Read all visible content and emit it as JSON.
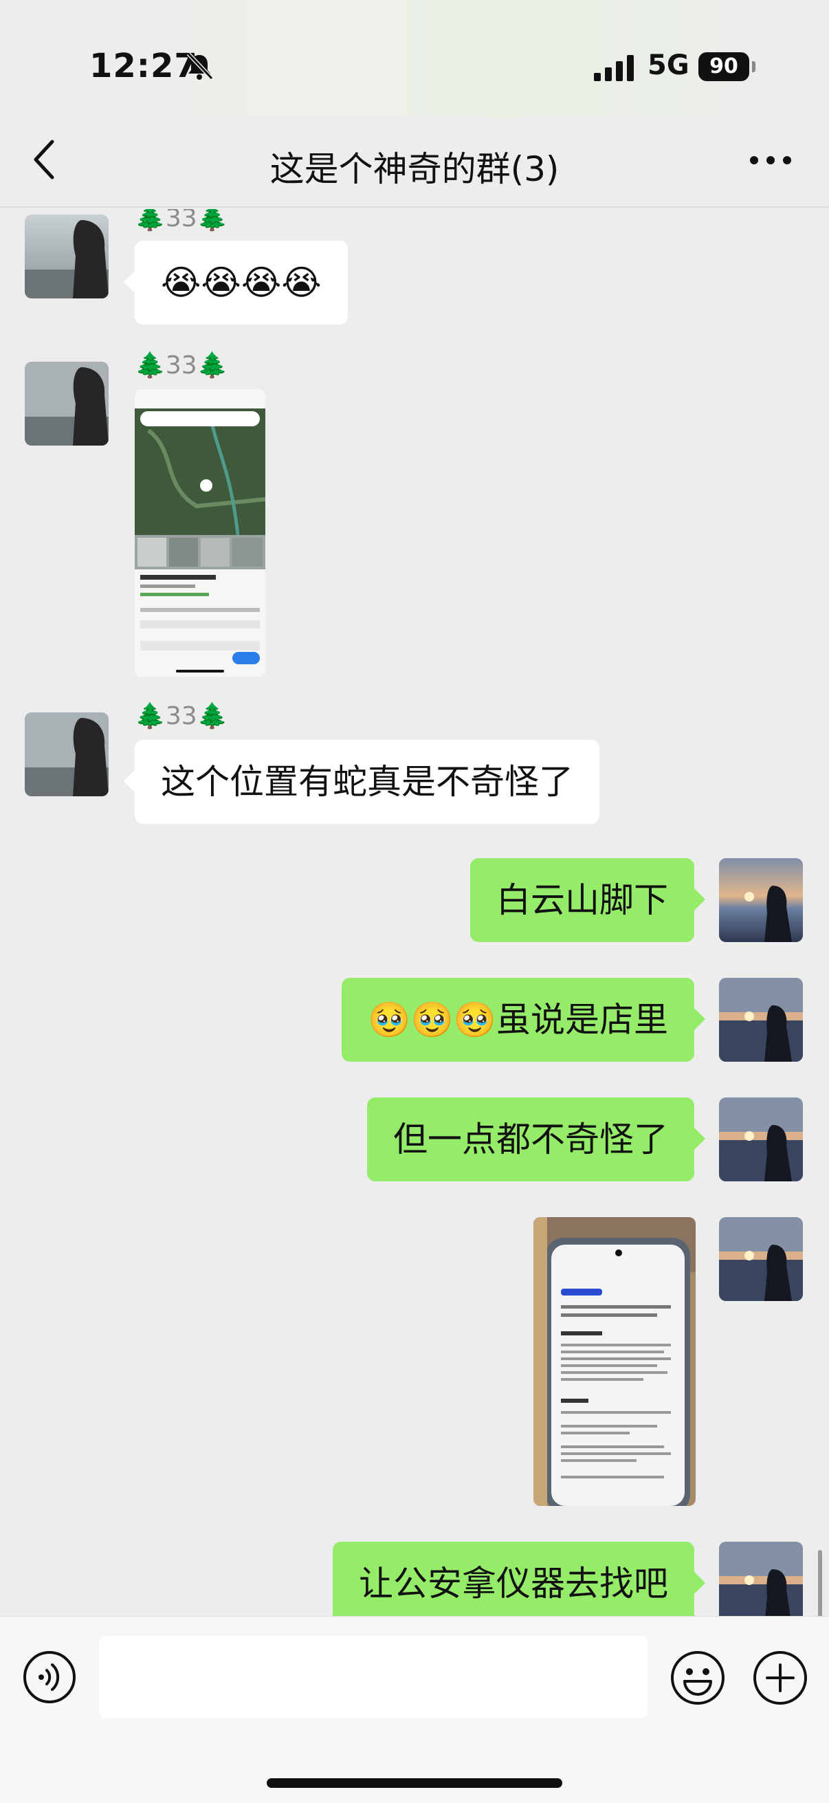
{
  "status_bar": {
    "time": "12:27",
    "network": "5G",
    "battery": "90"
  },
  "nav": {
    "title": "这是个神奇的群(3)"
  },
  "messages": [
    {
      "direction": "incoming",
      "sender": "🌲33🌲",
      "type": "text",
      "text": "😭😭😭😭"
    },
    {
      "direction": "incoming",
      "sender": "🌲33🌲",
      "type": "image",
      "image_desc": "map-screenshot"
    },
    {
      "direction": "incoming",
      "sender": "🌲33🌲",
      "type": "text",
      "text": "这个位置有蛇真是不奇怪了"
    },
    {
      "direction": "outgoing",
      "type": "text",
      "text": "白云山脚下"
    },
    {
      "direction": "outgoing",
      "type": "text",
      "text": "🥹🥹🥹虽说是店里"
    },
    {
      "direction": "outgoing",
      "type": "text",
      "text": "但一点都不奇怪了"
    },
    {
      "direction": "outgoing",
      "type": "image",
      "image_desc": "phone-photo"
    },
    {
      "direction": "outgoing",
      "type": "text",
      "text": "让公安拿仪器去找吧"
    }
  ],
  "icons": {
    "back": "chevron-left-icon",
    "more": "more-icon",
    "mute": "bell-slash-icon",
    "voice": "voice-icon",
    "emoji": "emoji-icon",
    "plus": "plus-icon"
  },
  "colors": {
    "outgoing_bubble": "#95ec69",
    "incoming_bubble": "#ffffff",
    "background": "#ededed"
  }
}
